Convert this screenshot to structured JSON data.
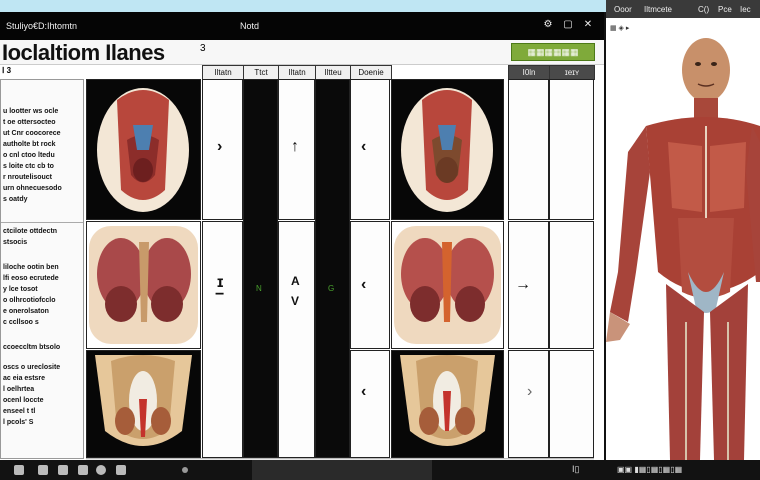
{
  "main_window": {
    "title_left": "Stuliyo€D:Ihtomtn",
    "title_center": "Notd",
    "controls": [
      "⚙",
      "▢",
      "✕"
    ],
    "app_title": "Ioclaltiom Ilanes",
    "app_title_sup": "3",
    "green_button": "▦▦▦▦▦▦ ▦▦▦▦",
    "small_label": "Ⅰ 3"
  },
  "columns": [
    "Iltatn",
    "Ttct",
    "Iltatn",
    "Iltteu",
    "Doenie",
    "Ⅰ0ln",
    "ɪeɪʏ"
  ],
  "left_panel": {
    "block1": [
      "u lootter ws ocle",
      "t oe ottersocteo",
      "ut Cnr coocorece",
      "autholte bt rock",
      "o cnl ctoo ltedu",
      "s loite ctc cb to",
      "r nroutelisouct",
      "urn ohnecuesodo",
      "s oatdy"
    ],
    "block2": [
      "ctcilote ottdectn",
      "stsocis"
    ],
    "block3": [
      "liloche ootin ben",
      "lfi eoso ecrutede",
      "y lce tosot",
      "o olhrcotiofcclo",
      "e onerolsaton",
      "c ccllsoo s"
    ],
    "block4": [
      "ccoeccltm btsolo"
    ],
    "block5": [
      "oscs o ureclosite",
      "ac eia estsre",
      "l oelhrtea",
      "ocenl  loccte",
      "enseel t tl",
      "l pcols' S"
    ]
  },
  "grid": {
    "arrows_row1": [
      "›",
      "↑",
      "‹"
    ],
    "arrows_row2": [
      "ɪ",
      "A",
      "‹",
      "→"
    ],
    "arrows_row2b": [
      "−",
      "V"
    ],
    "green_labels": [
      "N",
      "G"
    ],
    "arrows_row3": [
      "‹",
      "›"
    ]
  },
  "right_window": {
    "bar_items": [
      "Ooor",
      "Iltmcete",
      "C()",
      "Pce",
      "Iec"
    ],
    "subtitle": "▦ ◈ ▸"
  },
  "taskbar": {
    "time": "I▯",
    "right_text": "▣▣ ▮▦▯▦▯▦▯▦"
  }
}
